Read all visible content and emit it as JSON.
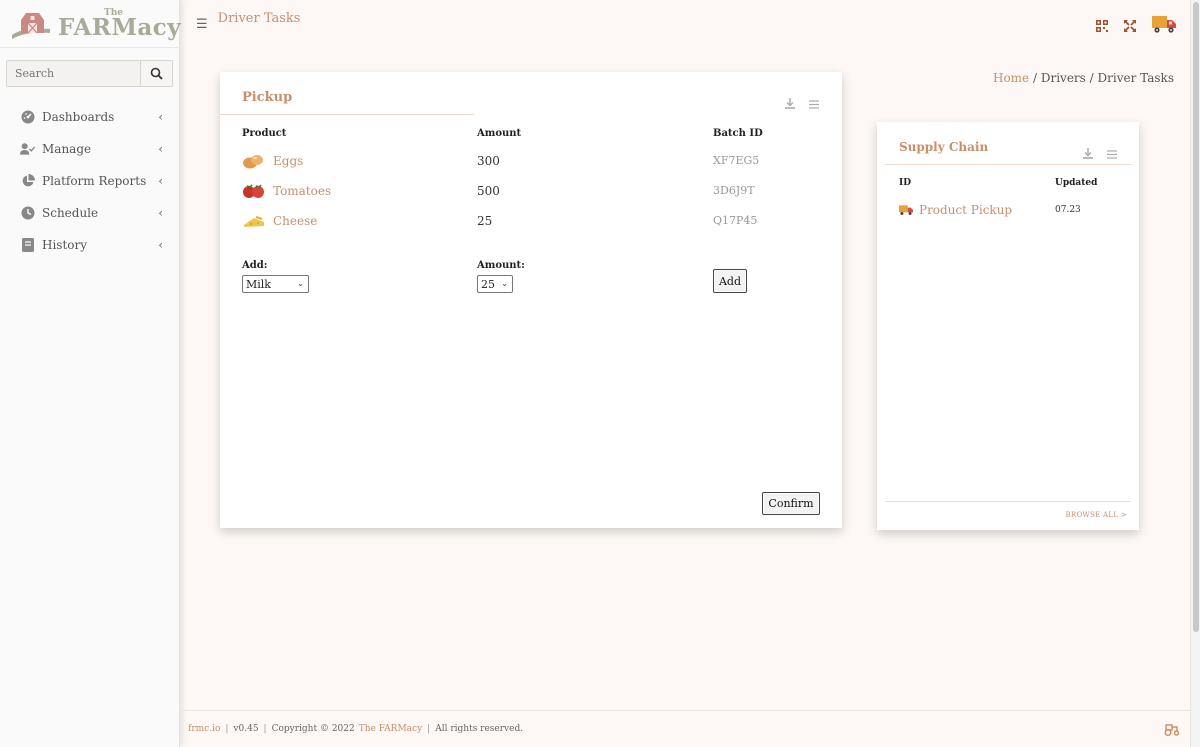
{
  "app": {
    "logo_the": "The",
    "logo_name": "FARMacy"
  },
  "sidebar": {
    "search_placeholder": "Search",
    "items": [
      {
        "label": "Dashboards",
        "icon": "dashboard-icon"
      },
      {
        "label": "Manage",
        "icon": "user-check-icon"
      },
      {
        "label": "Platform Reports",
        "icon": "pie-chart-icon"
      },
      {
        "label": "Schedule",
        "icon": "clock-icon"
      },
      {
        "label": "History",
        "icon": "book-icon"
      }
    ]
  },
  "header": {
    "title": "Driver Tasks"
  },
  "breadcrumb": {
    "home": "Home",
    "sep1": "/",
    "drivers": "Drivers",
    "sep2": "/",
    "current": "Driver Tasks"
  },
  "pickup": {
    "title": "Pickup",
    "columns": [
      "Product",
      "Amount",
      "Batch ID"
    ],
    "rows": [
      {
        "product": "Eggs",
        "amount": "300",
        "batch": "XF7EG5",
        "icon": "eggs-icon"
      },
      {
        "product": "Tomatoes",
        "amount": "500",
        "batch": "3D6J9T",
        "icon": "tomatoes-icon"
      },
      {
        "product": "Cheese",
        "amount": "25",
        "batch": "Q17P45",
        "icon": "cheese-icon"
      }
    ],
    "add_label": "Add:",
    "add_value": "Milk",
    "amount_label": "Amount:",
    "amount_value": "25",
    "add_button": "Add",
    "confirm_button": "Confirm"
  },
  "supply": {
    "title": "Supply Chain",
    "columns": [
      "ID",
      "Updated"
    ],
    "rows": [
      {
        "id": "Product Pickup",
        "updated": "07.23",
        "icon": "truck-icon"
      }
    ],
    "browse_all": "BROWSE ALL >"
  },
  "footer": {
    "domain": "frmc.io",
    "version": "v0.45",
    "copyright": "Copyright © 2022",
    "brand": "The FARMacy",
    "rights": "All rights reserved."
  },
  "colors": {
    "accent": "#c88f6c",
    "logo": "#a9ab98",
    "truck": "#e8a23a"
  }
}
